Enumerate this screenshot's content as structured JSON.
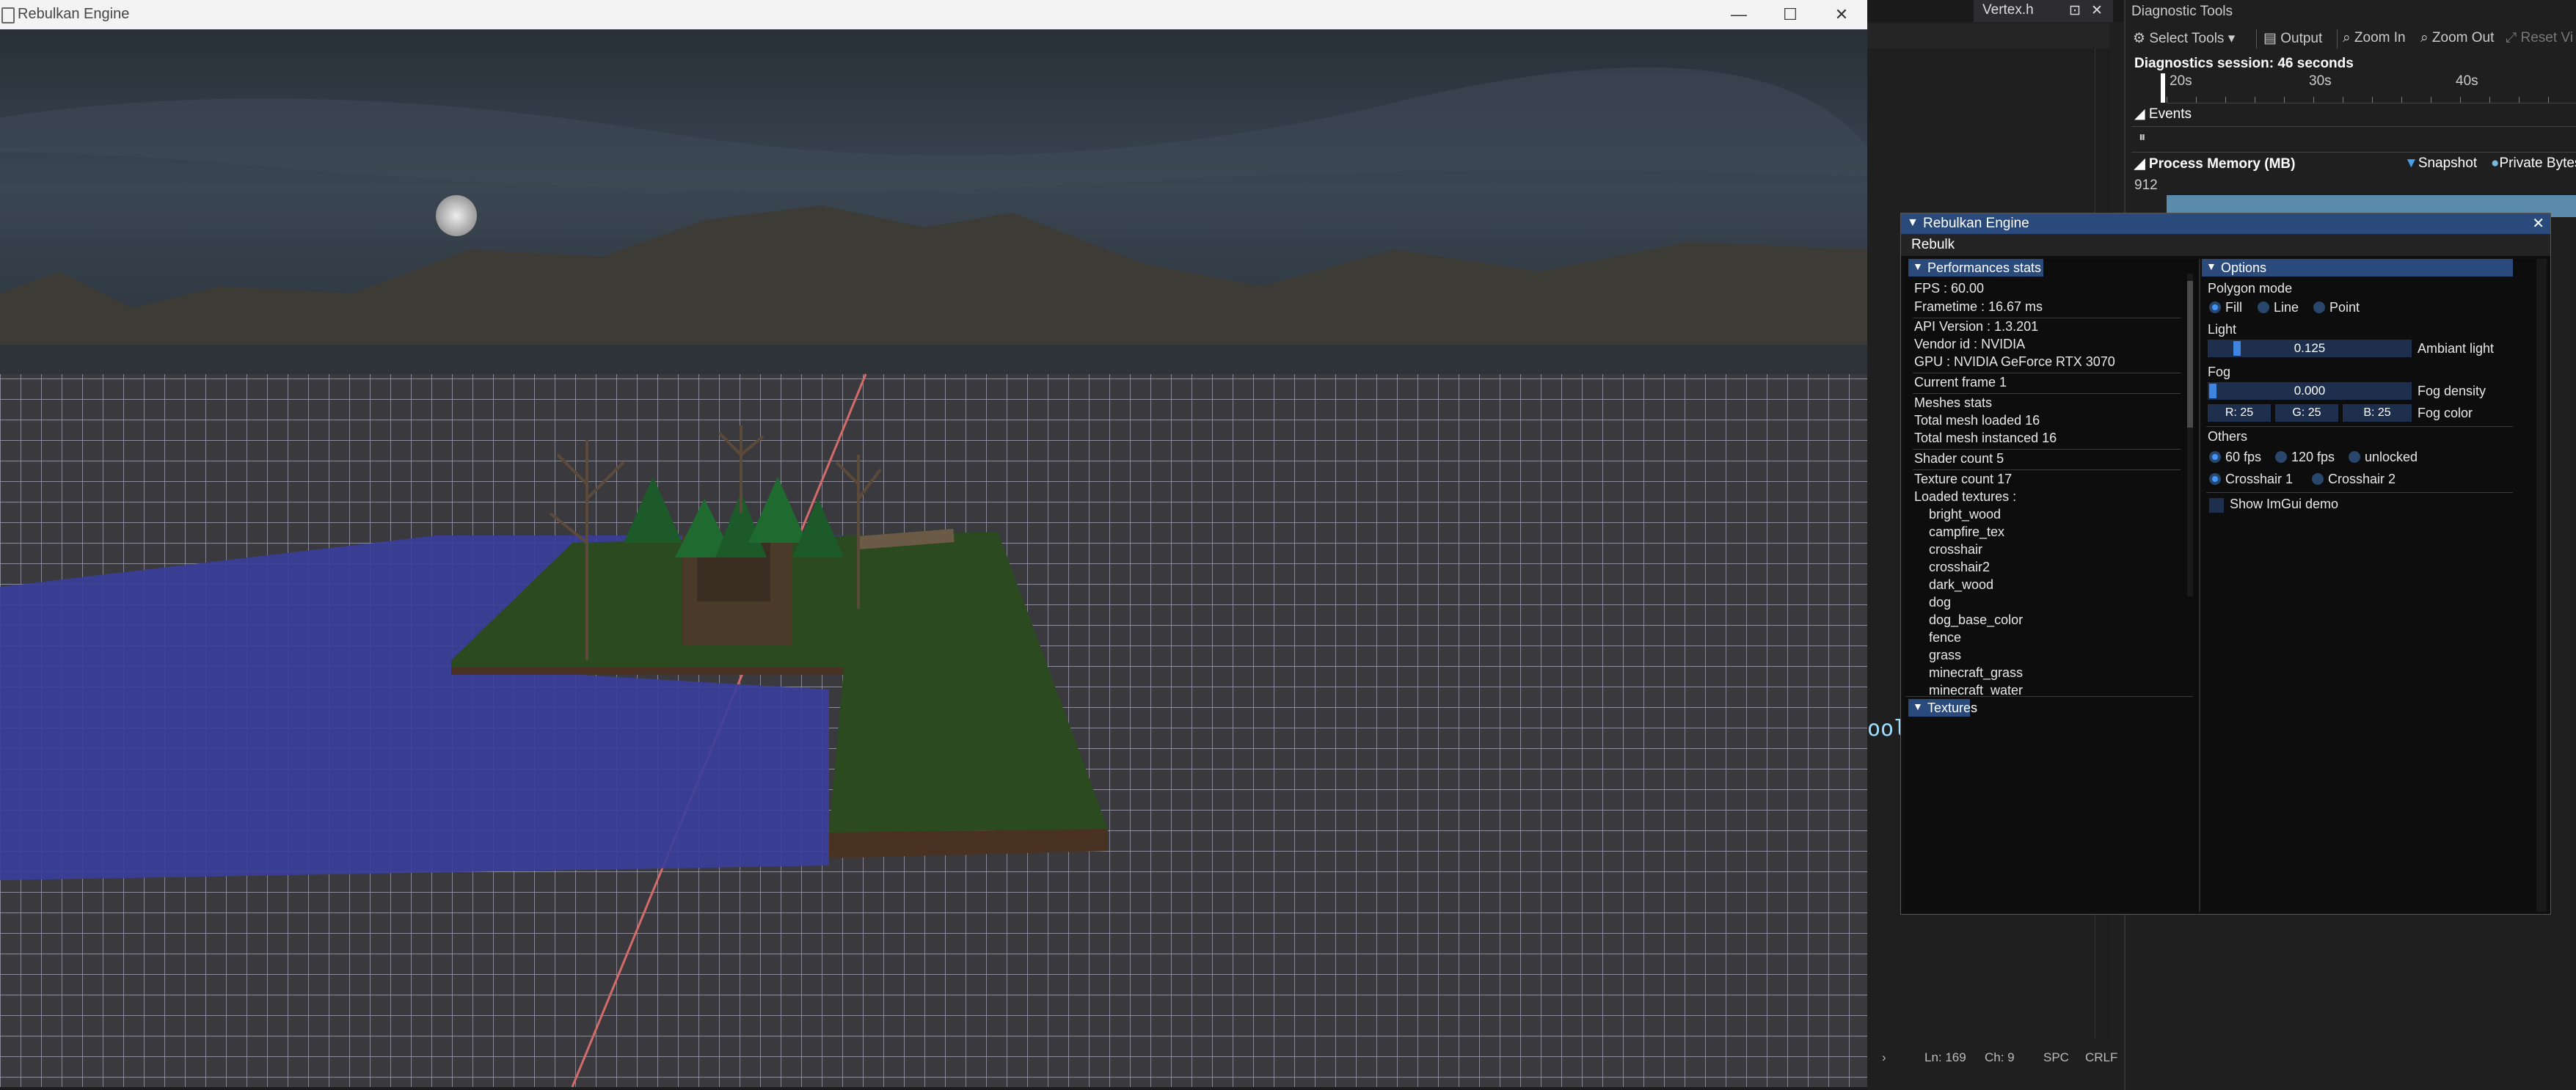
{
  "game_window": {
    "title": "Rebulkan Engine",
    "controls": {
      "minimize": "—",
      "maximize": "☐",
      "close": "✕"
    }
  },
  "vs": {
    "tab_label": "Vertex.h",
    "code_fragment": "ool",
    "status": {
      "line": "Ln: 169",
      "col": "Ch: 9",
      "spacing": "SPC",
      "eol": "CRLF"
    }
  },
  "diagnostics": {
    "title": "Diagnostic Tools",
    "toolbar": {
      "select_tools": "Select Tools ▾",
      "output": "Output",
      "zoom_in": "Zoom In",
      "zoom_out": "Zoom Out",
      "reset_view": "Reset Vi"
    },
    "session": "Diagnostics session: 46 seconds",
    "ruler": [
      "20s",
      "30s",
      "40s"
    ],
    "events_label": "Events",
    "memory": {
      "label": "Process Memory (MB)",
      "snapshot": "Snapshot",
      "private_bytes": "Private Bytes",
      "max_value": "912"
    }
  },
  "imgui": {
    "title": "Rebulkan Engine",
    "menu": "Rebulk",
    "perf": {
      "header": "Performances stats",
      "fps": "FPS : 60.00",
      "frametime": "Frametime : 16.67 ms",
      "api": "API Version : 1.3.201",
      "vendor": "Vendor id : NVIDIA",
      "gpu": "GPU : NVIDIA GeForce RTX 3070",
      "frame": "Current frame 1",
      "meshes": "Meshes stats",
      "mesh_loaded": "Total mesh loaded 16",
      "mesh_instanced": "Total mesh instanced 16",
      "shader_count": "Shader count 5",
      "texture_count": "Texture count 17",
      "loaded_textures": "Loaded textures :",
      "textures": [
        "bright_wood",
        "campfire_tex",
        "crosshair",
        "crosshair2",
        "dark_wood",
        "dog",
        "dog_base_color",
        "fence",
        "grass",
        "minecraft_grass",
        "minecraft_water"
      ],
      "textures_header": "Textures"
    },
    "options": {
      "header": "Options",
      "polygon_mode": "Polygon mode",
      "fill": "Fill",
      "line": "Line",
      "point": "Point",
      "light": "Light",
      "ambient_value": "0.125",
      "ambient_label": "Ambiant light",
      "ambient_fraction": 0.125,
      "fog": "Fog",
      "fog_value": "0.000",
      "fog_label": "Fog density",
      "fog_r": "R: 25",
      "fog_g": "G: 25",
      "fog_b": "B: 25",
      "fog_color_label": "Fog color",
      "others": "Others",
      "fps60": "60 fps",
      "fps120": "120 fps",
      "unlocked": "unlocked",
      "crosshair1": "Crosshair 1",
      "crosshair2": "Crosshair 2",
      "show_demo": "Show ImGui demo"
    }
  },
  "colors": {
    "imgui_header": "#294a7a",
    "imgui_accent": "#4296fa",
    "water": "#3b3f9a",
    "grass": "#2c4a1f",
    "grid": "#c8c8d2"
  }
}
